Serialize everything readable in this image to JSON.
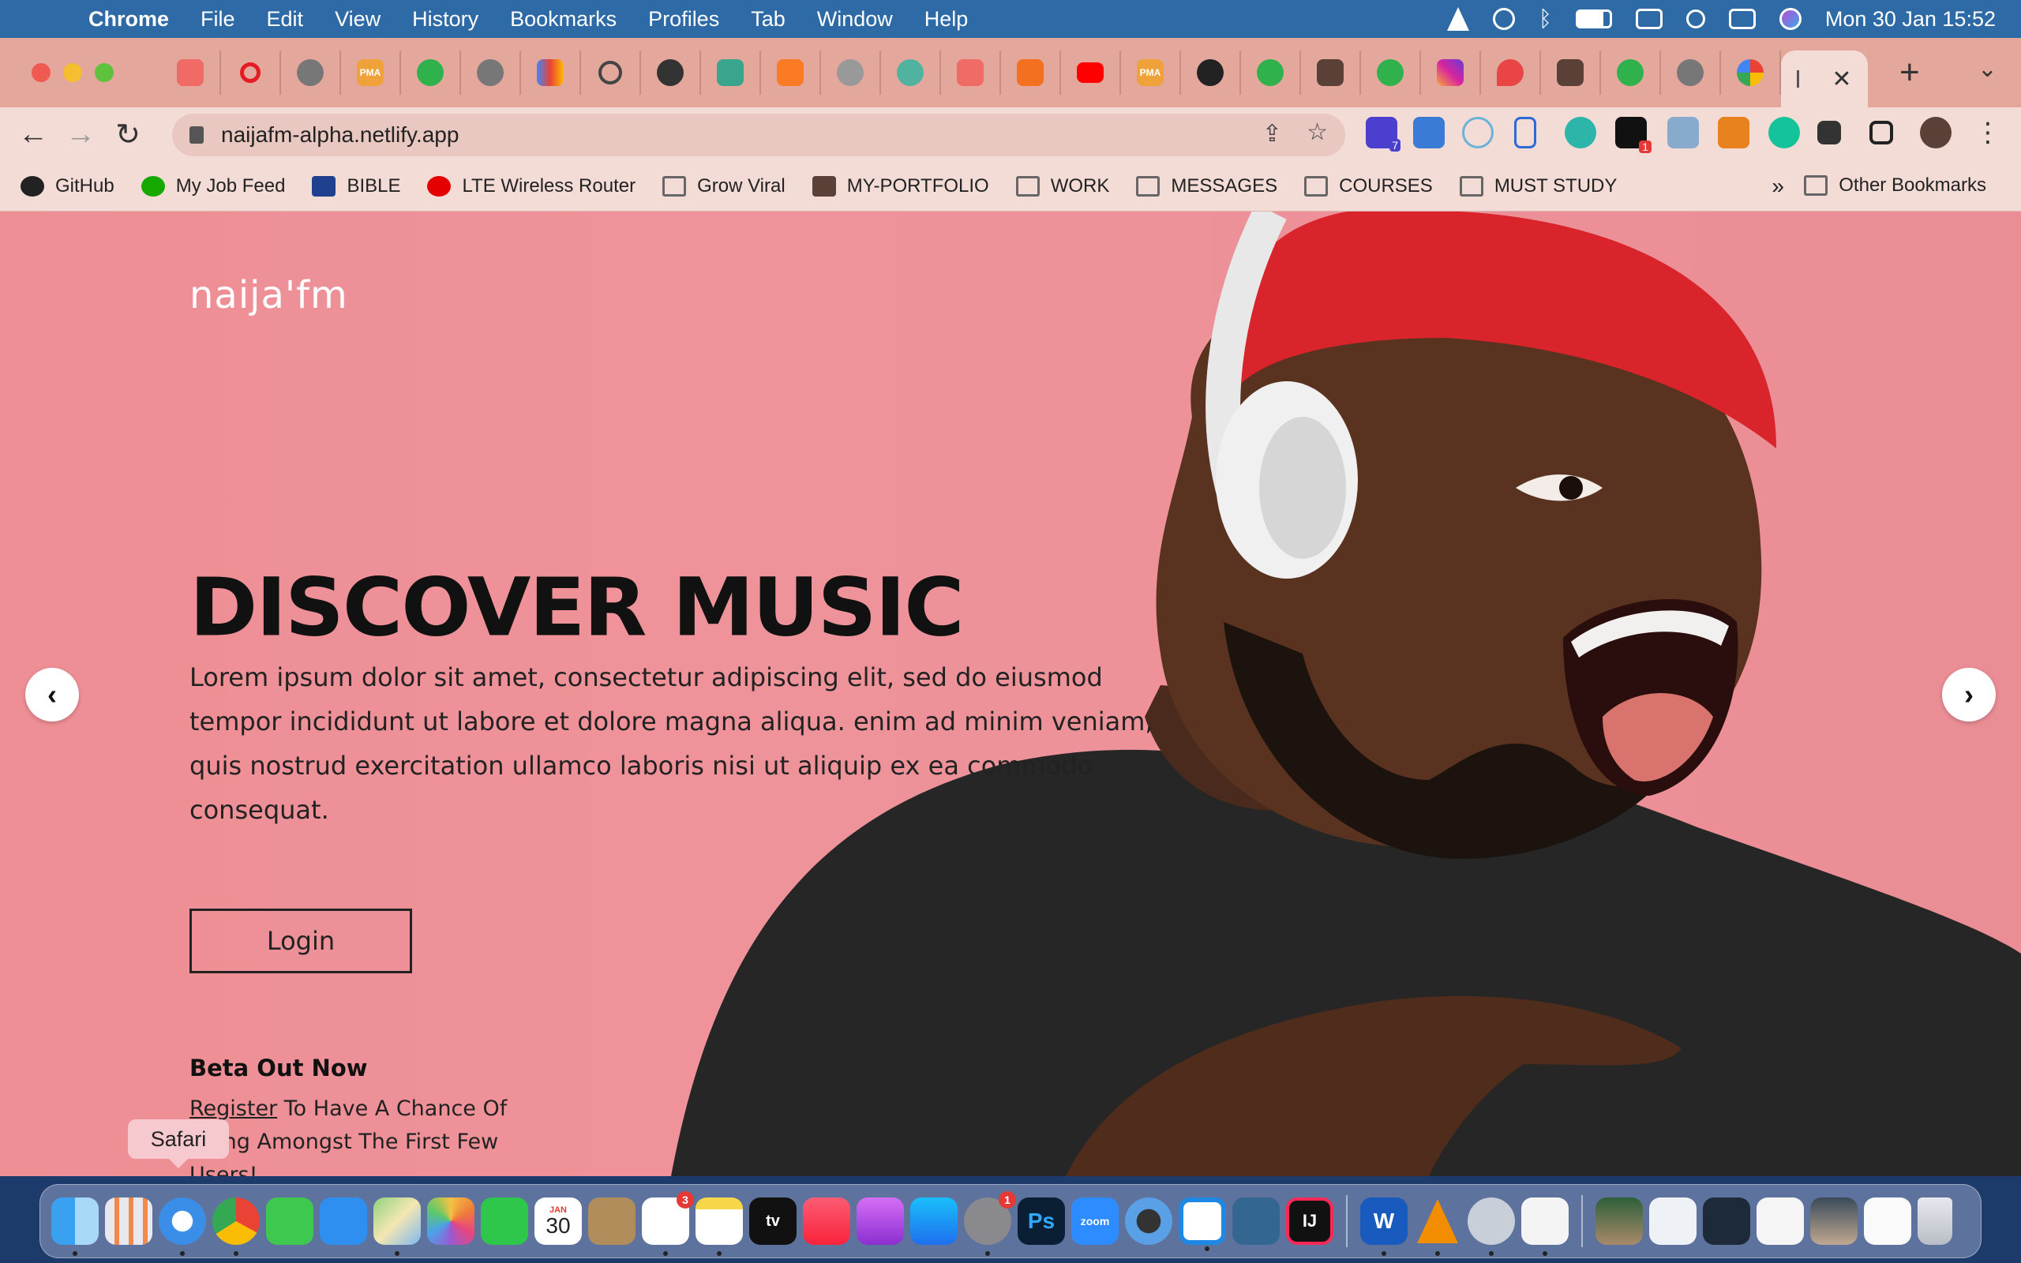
{
  "menubar": {
    "app": "Chrome",
    "items": [
      "File",
      "Edit",
      "View",
      "History",
      "Bookmarks",
      "Profiles",
      "Tab",
      "Window",
      "Help"
    ],
    "clock": "Mon 30 Jan  15:52"
  },
  "tabs": {
    "active_close": "✕",
    "new_tab": "+",
    "list_label": "⌄"
  },
  "toolbar": {
    "url": "naijafm-alpha.netlify.app",
    "back": "←",
    "forward": "→",
    "reload": "↻",
    "extension_badges": [
      "7",
      "1"
    ]
  },
  "bookmarks": {
    "items": [
      "GitHub",
      "My Job Feed",
      "BIBLE",
      "LTE Wireless Router",
      "Grow Viral",
      "MY-PORTFOLIO",
      "WORK",
      "MESSAGES",
      "COURSES",
      "MUST STUDY"
    ],
    "more": "»",
    "other": "Other Bookmarks"
  },
  "hero": {
    "logo": "naija'fm",
    "headline": "DISCOVER MUSIC",
    "description": "Lorem ipsum dolor sit amet, consectetur adipiscing elit, sed do eiusmod tempor incididunt ut labore et dolore magna aliqua. enim ad minim veniam, quis nostrud exercitation ullamco laboris nisi ut aliquip ex ea commodo consequat.",
    "login_label": "Login",
    "beta_title": "Beta Out Now",
    "beta_link": "Register",
    "beta_rest": " To Have A Chance Of Being Amongst The First Few Users!",
    "prev_arrow": "‹",
    "next_arrow": "›"
  },
  "dock": {
    "tooltip": "Safari",
    "calendar_month": "JAN",
    "calendar_day": "30",
    "reminders_badge": "3",
    "settings_badge": "1",
    "ps_label": "Ps",
    "zoom_label": "zoom",
    "tv_label": "tv",
    "ij_label": "IJ",
    "word_label": "W"
  },
  "colors": {
    "hero_bg": "#ee8e95",
    "tabstrip": "#e4a79b",
    "toolbar": "#f3dbd6",
    "menubar": "#2e6aa6"
  }
}
